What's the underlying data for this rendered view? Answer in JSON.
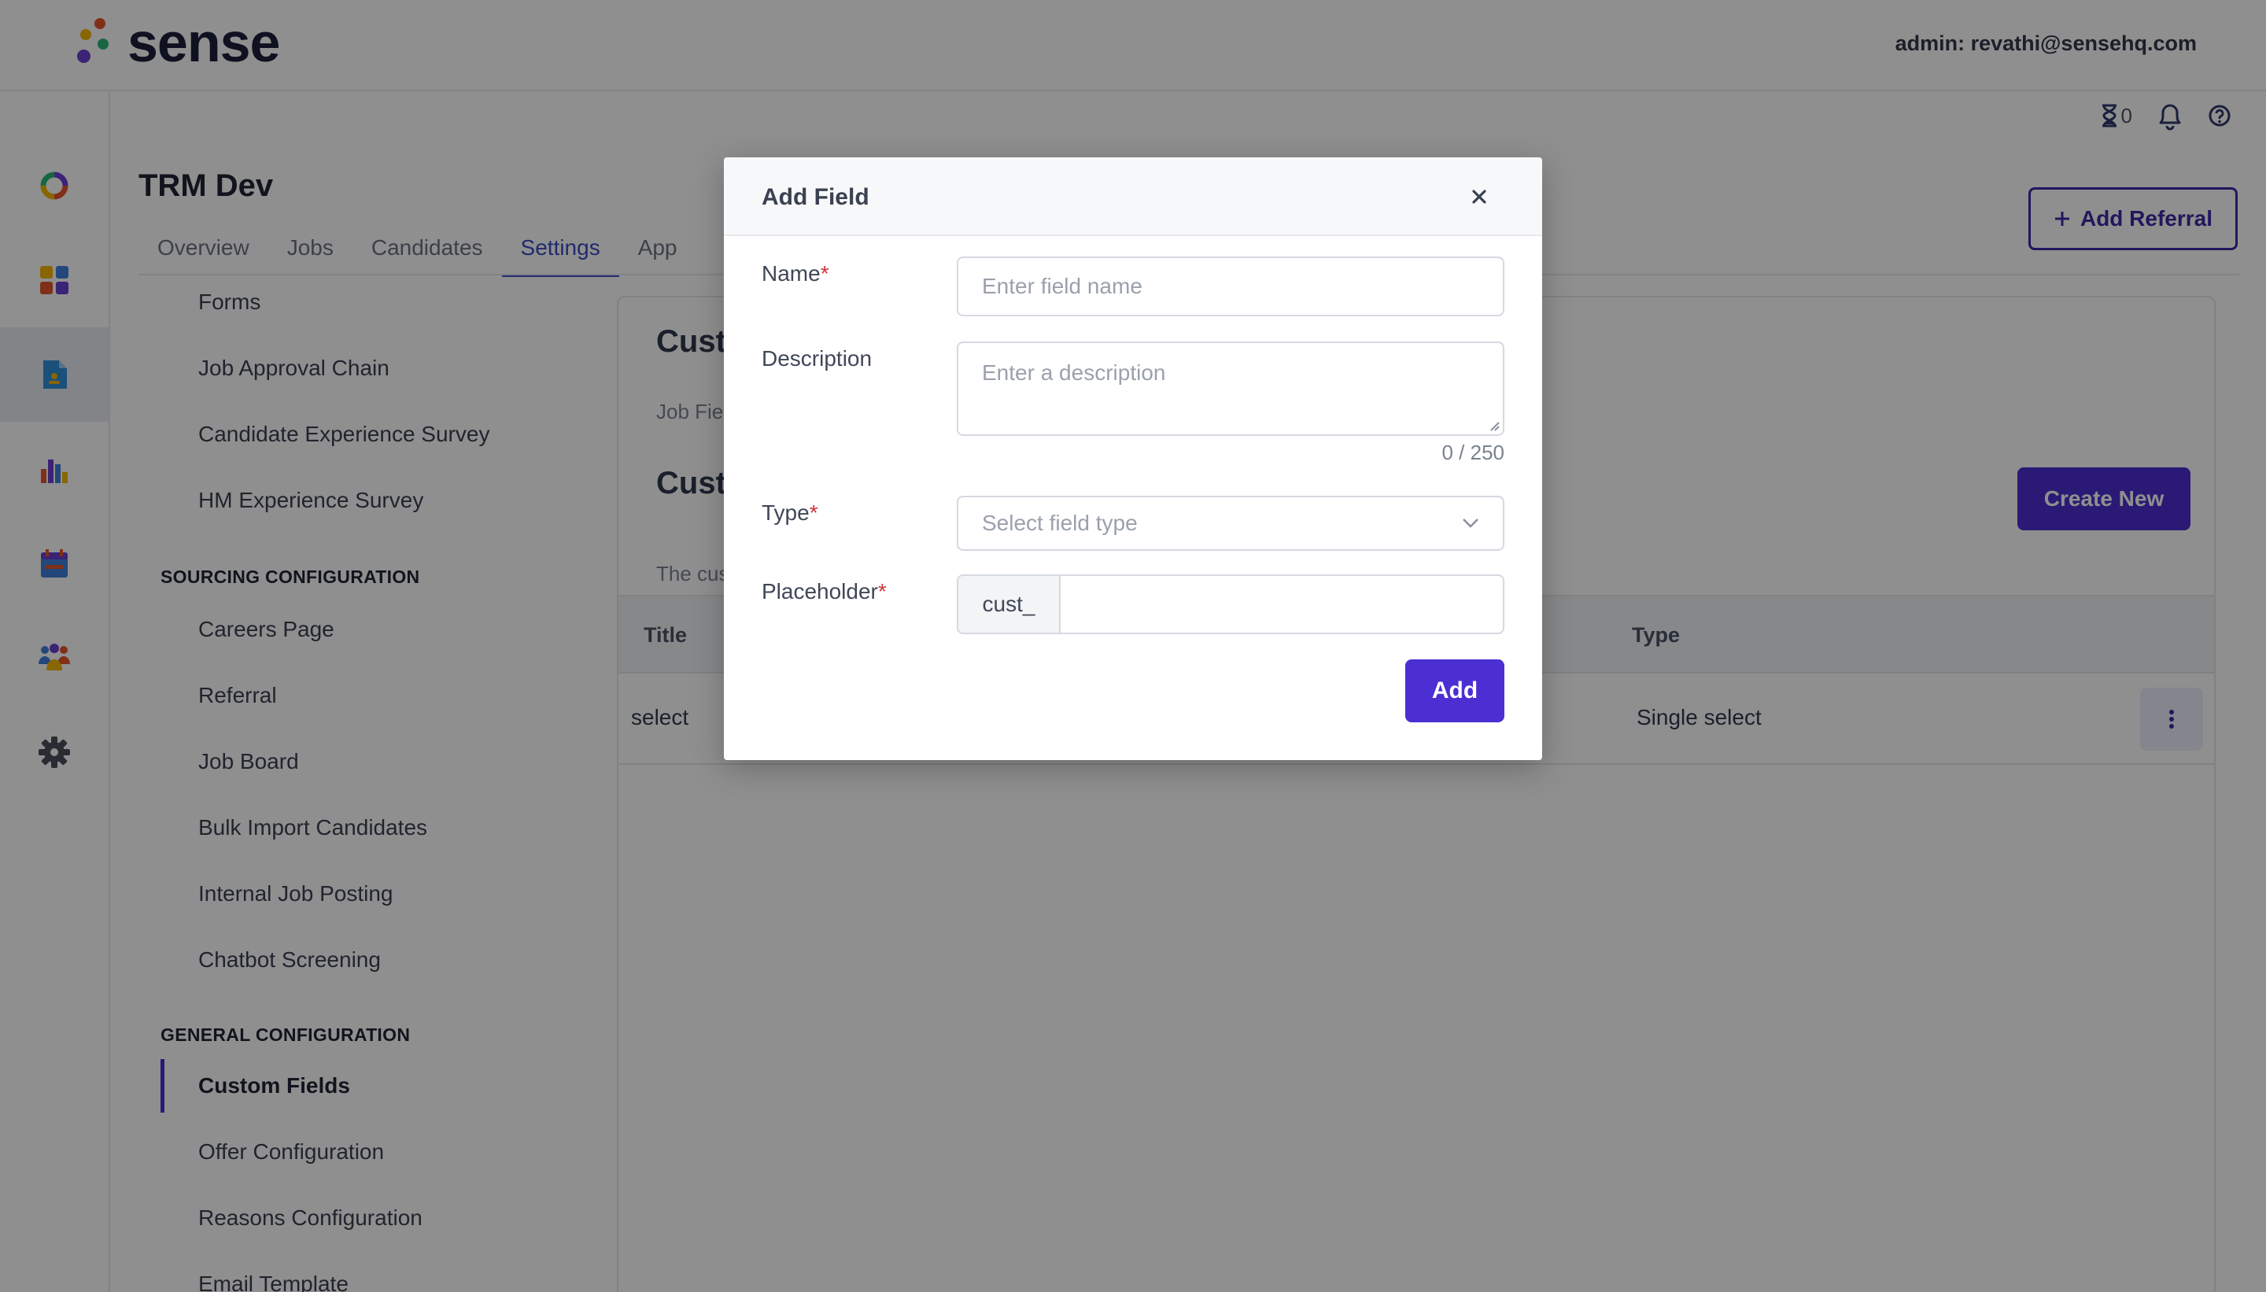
{
  "header": {
    "brand": "sense",
    "admin_label": "admin: revathi@sensehq.com"
  },
  "utility": {
    "pending_count": "0"
  },
  "page": {
    "title": "TRM Dev",
    "tabs": [
      "Overview",
      "Jobs",
      "Candidates",
      "Settings",
      "App"
    ],
    "active_tab": "Settings",
    "add_referral_label": "Add Referral"
  },
  "settings_nav": {
    "items_top": [
      "Forms",
      "Job Approval Chain",
      "Candidate Experience Survey",
      "HM Experience Survey"
    ],
    "sourcing_section": "SOURCING CONFIGURATION",
    "sourcing_items": [
      "Careers Page",
      "Referral",
      "Job Board",
      "Bulk Import Candidates",
      "Internal Job Posting",
      "Chatbot Screening"
    ],
    "general_section": "GENERAL CONFIGURATION",
    "general_items": [
      "Custom Fields",
      "Offer Configuration",
      "Reasons Configuration",
      "Email Template"
    ],
    "active_item": "Custom Fields"
  },
  "content": {
    "title": "Cust",
    "subtitle": "Job Fie",
    "heading2": "Cust",
    "description": "The cus",
    "create_new_label": "Create New",
    "table": {
      "headers": [
        "Title",
        "Type"
      ],
      "rows": [
        {
          "title": "select",
          "type": "Single select"
        }
      ]
    }
  },
  "modal": {
    "title": "Add Field",
    "name_label": "Name",
    "name_placeholder": "Enter field name",
    "description_label": "Description",
    "description_placeholder": "Enter a description",
    "counter": "0 / 250",
    "type_label": "Type",
    "type_placeholder": "Select field type",
    "placeholder_label": "Placeholder",
    "placeholder_prefix": "cust_",
    "placeholder_value": "",
    "required_mark": "*",
    "add_label": "Add"
  },
  "colors": {
    "accent": "#4b2fd3",
    "tab_active": "#3a4bc2",
    "required": "#d2343a"
  }
}
